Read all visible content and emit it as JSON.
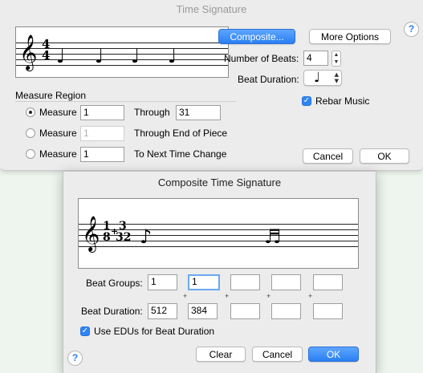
{
  "dialog1": {
    "title": "Time Signature",
    "composite_btn": "Composite...",
    "more_options_btn": "More Options",
    "num_beats_label": "Number of Beats:",
    "num_beats_value": "4",
    "beat_duration_label": "Beat Duration:",
    "beat_duration_glyph": "♩",
    "rebar_label": "Rebar Music",
    "measure_region_label": "Measure Region",
    "rows": [
      {
        "label": "Measure",
        "value": "1",
        "through_label": "Through",
        "through_value": "31"
      },
      {
        "label": "Measure",
        "value": "1",
        "through_label": "Through End of Piece"
      },
      {
        "label": "Measure",
        "value": "1",
        "through_label": "To Next Time Change"
      }
    ],
    "cancel_btn": "Cancel",
    "ok_btn": "OK",
    "help": "?"
  },
  "dialog2": {
    "title": "Composite Time Signature",
    "beat_groups_label": "Beat Groups:",
    "beat_groups": [
      "1",
      "1",
      "",
      "",
      ""
    ],
    "beat_duration_label": "Beat Duration:",
    "beat_durations": [
      "512",
      "384",
      "",
      "",
      ""
    ],
    "plus": "+",
    "use_edus_label": "Use EDUs for Beat Duration",
    "clear_btn": "Clear",
    "cancel_btn": "Cancel",
    "ok_btn": "OK",
    "help": "?"
  },
  "staff1": {
    "clef": "𝄞",
    "time_top": "4",
    "time_bottom": "4",
    "notes": [
      "♩",
      "♩",
      "♩",
      "♩"
    ]
  },
  "staff2": {
    "clef": "𝄞",
    "time_top": "1",
    "time_bottom": "8",
    "time2_top": "3",
    "time2_bottom": "32",
    "plus": "+",
    "notes": [
      "♪",
      "♬"
    ]
  }
}
